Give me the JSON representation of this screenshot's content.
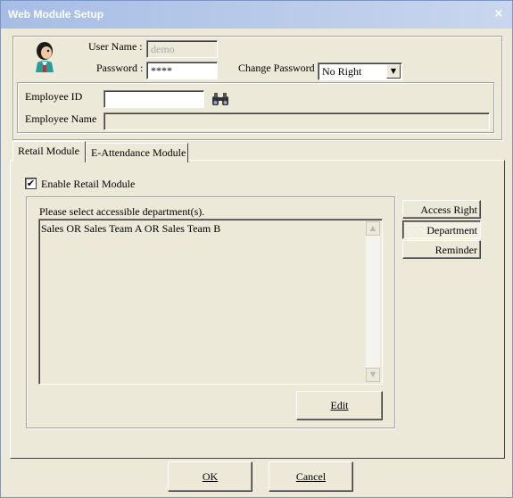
{
  "window": {
    "title": "Web Module Setup",
    "close_glyph": "×"
  },
  "user": {
    "username_label": "User Name :",
    "username_value": "demo",
    "password_label": "Password :",
    "password_value": "****",
    "change_password_label": "Change Password",
    "change_password_value": "No Right"
  },
  "employee": {
    "id_label": "Employee ID",
    "id_value": "",
    "name_label": "Employee Name",
    "name_value": ""
  },
  "tabs": [
    {
      "label": "Retail Module",
      "selected": true
    },
    {
      "label": "E-Attendance Module",
      "selected": false
    }
  ],
  "retail": {
    "enable_label": "Enable Retail Module",
    "enable_checked": true,
    "check_glyph": "✔",
    "group_caption": "Please select accessible department(s).",
    "departments_text": "Sales OR Sales Team A OR Sales Team B",
    "edit_label": "Edit"
  },
  "side_buttons": {
    "access_right": "Access Right",
    "department": "Department",
    "reminder": "Reminder"
  },
  "footer": {
    "ok_label": "OK",
    "cancel_label": "Cancel"
  },
  "icons": {
    "user_avatar": "user-avatar-icon",
    "search": "binoculars-icon",
    "scroll_up": "▲",
    "scroll_down": "▼",
    "dropdown": "▼"
  }
}
